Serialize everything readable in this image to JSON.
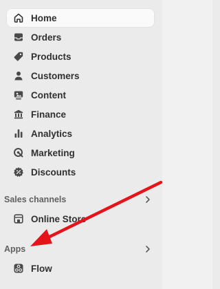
{
  "nav": {
    "items": [
      {
        "label": "Home",
        "icon": "home-icon"
      },
      {
        "label": "Orders",
        "icon": "inbox-icon"
      },
      {
        "label": "Products",
        "icon": "tag-icon"
      },
      {
        "label": "Customers",
        "icon": "person-icon"
      },
      {
        "label": "Content",
        "icon": "image-icon"
      },
      {
        "label": "Finance",
        "icon": "bank-icon"
      },
      {
        "label": "Analytics",
        "icon": "bar-chart-icon"
      },
      {
        "label": "Marketing",
        "icon": "target-icon"
      },
      {
        "label": "Discounts",
        "icon": "discount-icon"
      }
    ],
    "active_index": 0
  },
  "sales_channels": {
    "title": "Sales channels",
    "items": [
      {
        "label": "Online Store",
        "icon": "store-icon"
      }
    ]
  },
  "apps": {
    "title": "Apps",
    "items": [
      {
        "label": "Flow",
        "icon": "flow-icon"
      }
    ]
  },
  "colors": {
    "sidebar_bg": "#ebebeb",
    "active_bg": "#fafafa",
    "text": "#303030",
    "section_text": "#616161",
    "annotation_arrow": "#e5141b"
  }
}
